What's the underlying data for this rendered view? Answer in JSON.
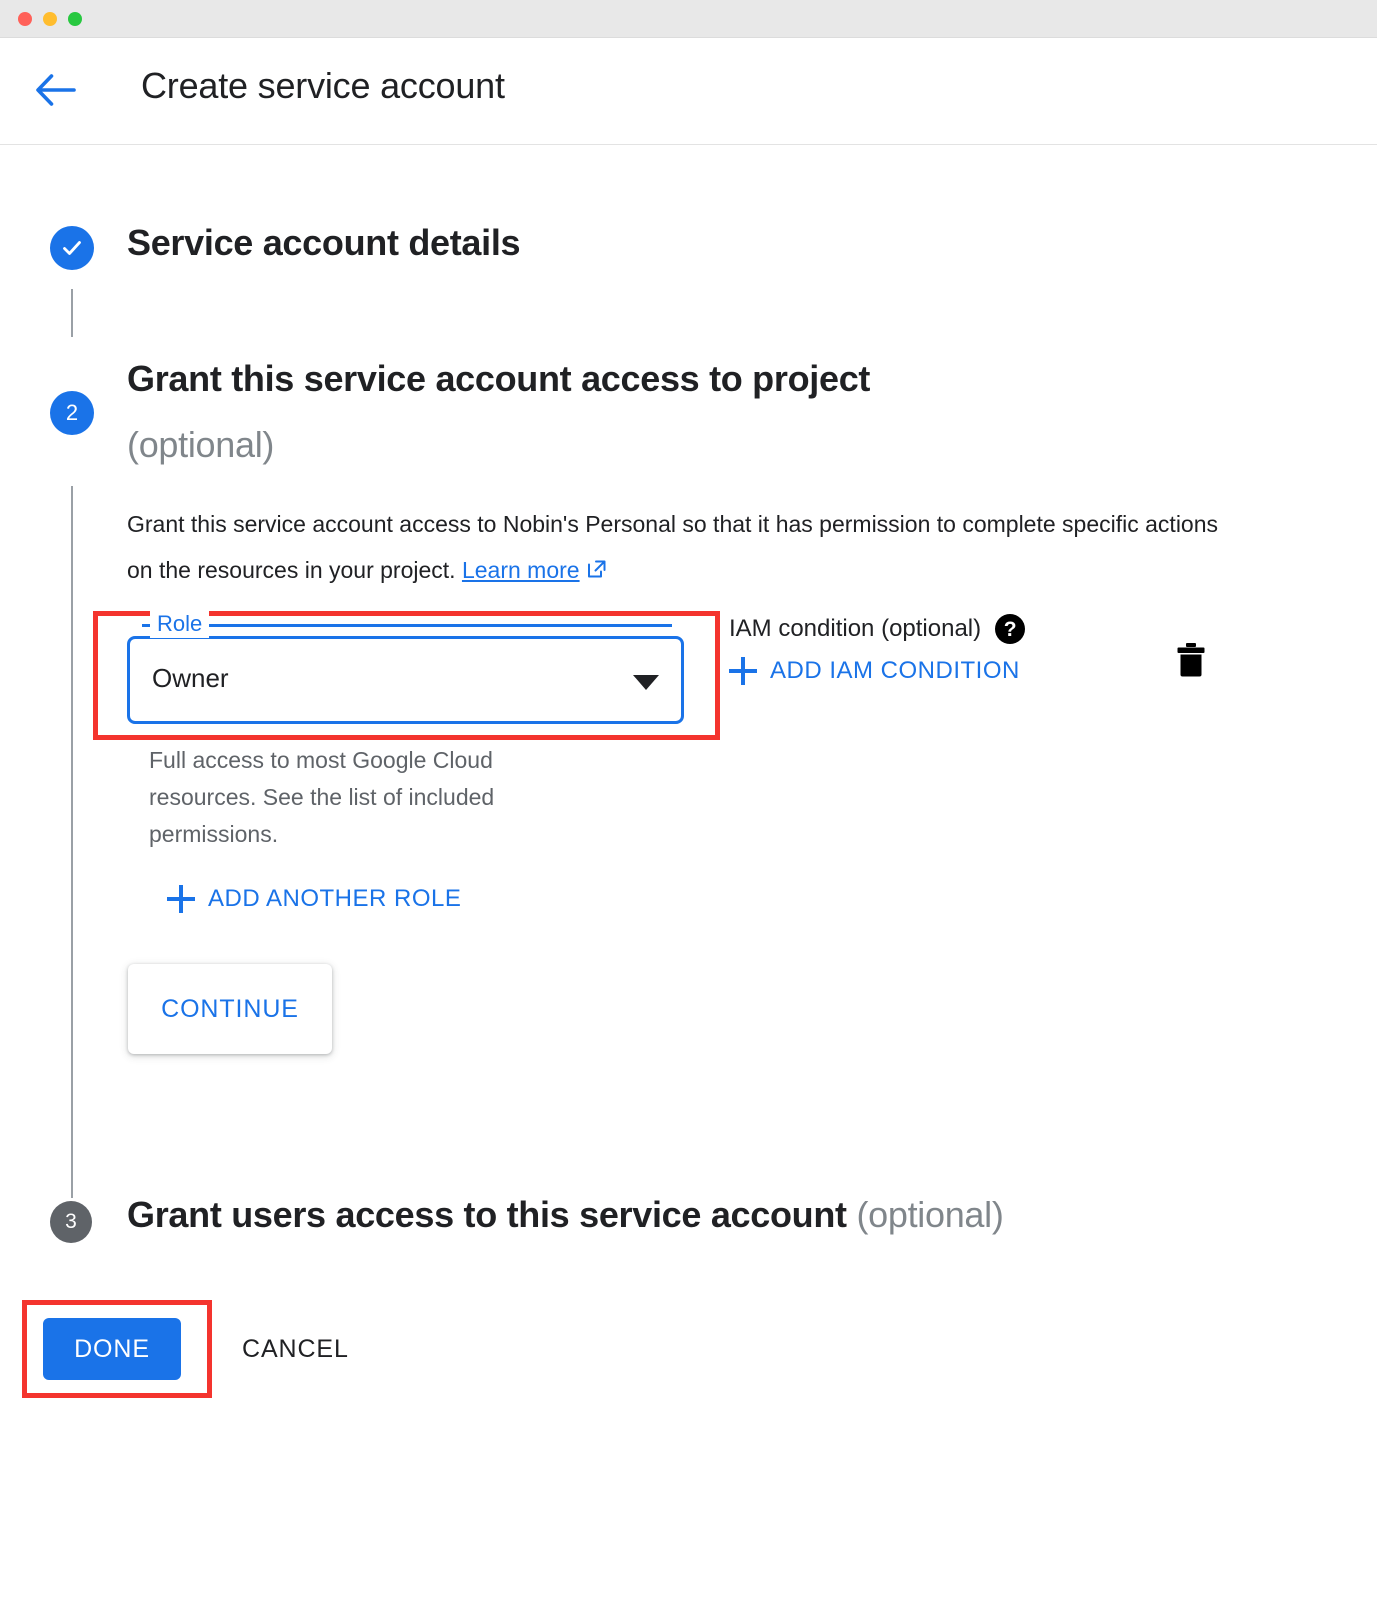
{
  "window": {
    "traffic_lights": [
      "close-red",
      "minimize-yellow",
      "zoom-green"
    ]
  },
  "header": {
    "back_icon": "arrow-left-icon",
    "title": "Create service account"
  },
  "steps": [
    {
      "number": "",
      "state": "complete",
      "icon": "check-icon",
      "title": "Service account details"
    },
    {
      "number": "2",
      "state": "active",
      "title": "Grant this service account access to project",
      "optional": "(optional)"
    },
    {
      "number": "3",
      "state": "inactive",
      "title": "Grant users access to this service account",
      "optional": "(optional)"
    }
  ],
  "step2": {
    "description_part1": "Grant this service account access to Nobin's Personal so that it has permission to complete specific actions on the resources in your project.",
    "learn_more": "Learn more",
    "learn_more_icon": "external-link-icon",
    "role_field": {
      "label": "Role",
      "value": "Owner",
      "dropdown_icon": "chevron-down-icon",
      "help_text": "Full access to most Google Cloud resources. See the list of included permissions."
    },
    "iam_condition": {
      "label": "IAM condition (optional)",
      "help_icon": "help-circle-icon",
      "add_button": "ADD IAM CONDITION",
      "add_icon": "plus-icon"
    },
    "delete_icon": "trash-icon",
    "add_another_role": "ADD ANOTHER ROLE",
    "add_another_role_icon": "plus-icon",
    "continue_button": "CONTINUE"
  },
  "footer": {
    "done_button": "DONE",
    "cancel_button": "CANCEL"
  },
  "colors": {
    "accent_blue": "#1a73e8",
    "highlight_red": "#f4342e",
    "inactive_grey": "#5f6368",
    "muted_text": "#80868b"
  }
}
